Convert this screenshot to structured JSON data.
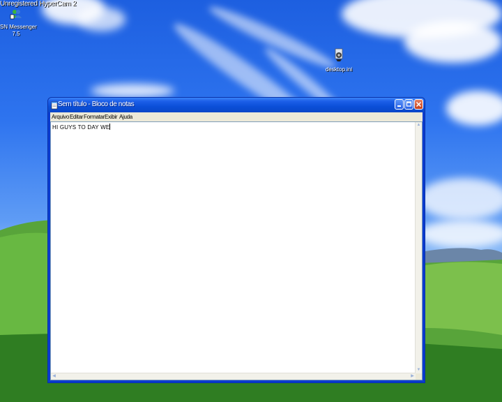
{
  "recording_banner": "Unregistered HyperCam 2",
  "desktop_icons": [
    {
      "label": "MSN Messenger",
      "sublabel": "7.5"
    },
    {
      "label": "desktop.ini"
    }
  ],
  "notepad": {
    "title": "Sem título - Bloco de notas",
    "menu": [
      "Arquivo",
      "Editar",
      "Formatar",
      "Exibir",
      "Ajuda"
    ],
    "content": "HI GUYS TO DAY WE"
  },
  "colors": {
    "title_bar": "#0a4fd8",
    "close_button": "#d4502a",
    "menu_bar": "#ece9d8"
  }
}
